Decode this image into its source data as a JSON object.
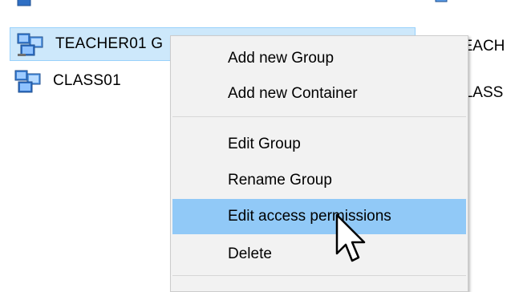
{
  "tree": {
    "items": [
      {
        "label": "TEACHER01 G",
        "icon": "group-icon",
        "selected": true
      },
      {
        "label": "CLASS01",
        "icon": "group-icon",
        "selected": false
      }
    ]
  },
  "right_panel": {
    "items": [
      {
        "label": "TEACH",
        "icon": "group-icon"
      },
      {
        "label": "CLASS",
        "icon": "group-icon"
      }
    ]
  },
  "context_menu": {
    "items": [
      {
        "label": "Add new Group"
      },
      {
        "label": "Add new Container"
      },
      {
        "label": "Edit Group"
      },
      {
        "label": "Rename Group"
      },
      {
        "label": "Edit access permissions",
        "highlighted": true
      },
      {
        "label": "Delete"
      }
    ]
  },
  "colors": {
    "selection_bg": "#cde8fb",
    "menu_highlight": "#91c9f7",
    "menu_bg": "#f2f2f2"
  }
}
